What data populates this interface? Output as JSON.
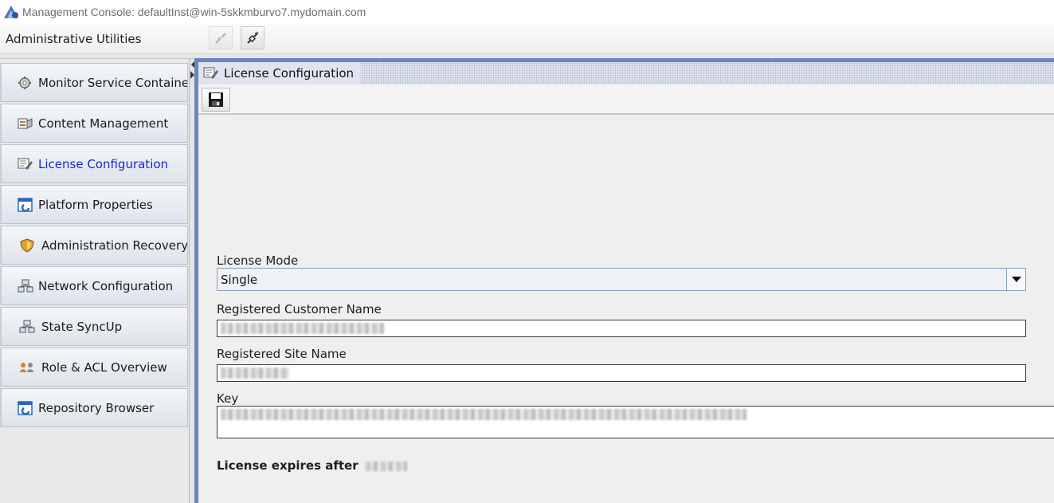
{
  "window": {
    "title": "Management Console: defaultInst@win-5skkmburvo7.mydomain.com"
  },
  "toolbar": {
    "title": "Administrative Utilities",
    "buttons": [
      {
        "icon": "disconnect-icon",
        "enabled": false
      },
      {
        "icon": "connect-icon",
        "enabled": true
      }
    ]
  },
  "sidebar": {
    "items": [
      {
        "label": "Monitor Service Containers",
        "icon": "monitor-gear-icon"
      },
      {
        "label": "Content Management",
        "icon": "content-management-icon"
      },
      {
        "label": "License Configuration",
        "icon": "license-icon",
        "active": true
      },
      {
        "label": "Platform Properties",
        "icon": "properties-window-icon"
      },
      {
        "label": "Administration Recovery",
        "icon": "shield-icon"
      },
      {
        "label": "Network Configuration",
        "icon": "network-icon"
      },
      {
        "label": "State SyncUp",
        "icon": "network-sync-icon"
      },
      {
        "label": "Role & ACL Overview",
        "icon": "users-roles-icon"
      },
      {
        "label": "Repository Browser",
        "icon": "repository-window-icon"
      }
    ]
  },
  "panel": {
    "title": "License Configuration",
    "save_icon": "floppy-disk-icon",
    "fields": {
      "license_mode_label": "License Mode",
      "license_mode_value": "Single",
      "customer_name_label": "Registered Customer Name",
      "site_name_label": "Registered Site Name",
      "key_label": "Key"
    },
    "expires_label": "License expires after"
  },
  "colors": {
    "active_item_text": "#1a25c9",
    "frame_border": "#6a86c0"
  }
}
